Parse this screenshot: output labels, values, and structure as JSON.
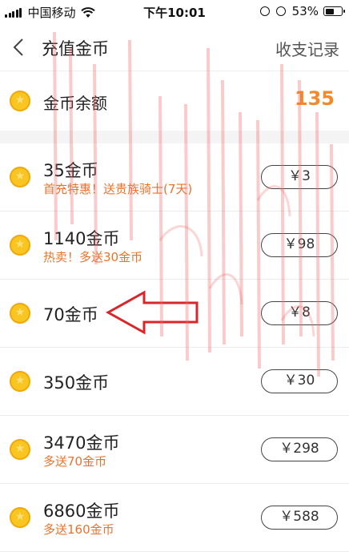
{
  "status_bar": {
    "carrier": "中国移动",
    "time": "下午10:01",
    "battery_percent": "53%",
    "battery_level": 0.53
  },
  "nav": {
    "back_icon": "chevron-left-icon",
    "title": "充值金币",
    "right_label": "收支记录"
  },
  "balance": {
    "label": "金币余额",
    "value": "135",
    "value_color": "#f28a2a"
  },
  "packages": [
    {
      "title": "35金币",
      "subtitle": "首充特惠！送贵族骑士(7天)",
      "price": "￥3"
    },
    {
      "title": "1140金币",
      "subtitle": "热卖！多送30金币",
      "price": "￥98"
    },
    {
      "title": "70金币",
      "subtitle": "",
      "price": "￥8"
    },
    {
      "title": "350金币",
      "subtitle": "",
      "price": "￥30"
    },
    {
      "title": "3470金币",
      "subtitle": "多送70金币",
      "price": "￥298"
    },
    {
      "title": "6860金币",
      "subtitle": "多送160金币",
      "price": "￥588"
    }
  ],
  "colors": {
    "accent_orange": "#e8732d",
    "coin_gold": "#f9c520",
    "annotation_red": "#d9262a"
  }
}
